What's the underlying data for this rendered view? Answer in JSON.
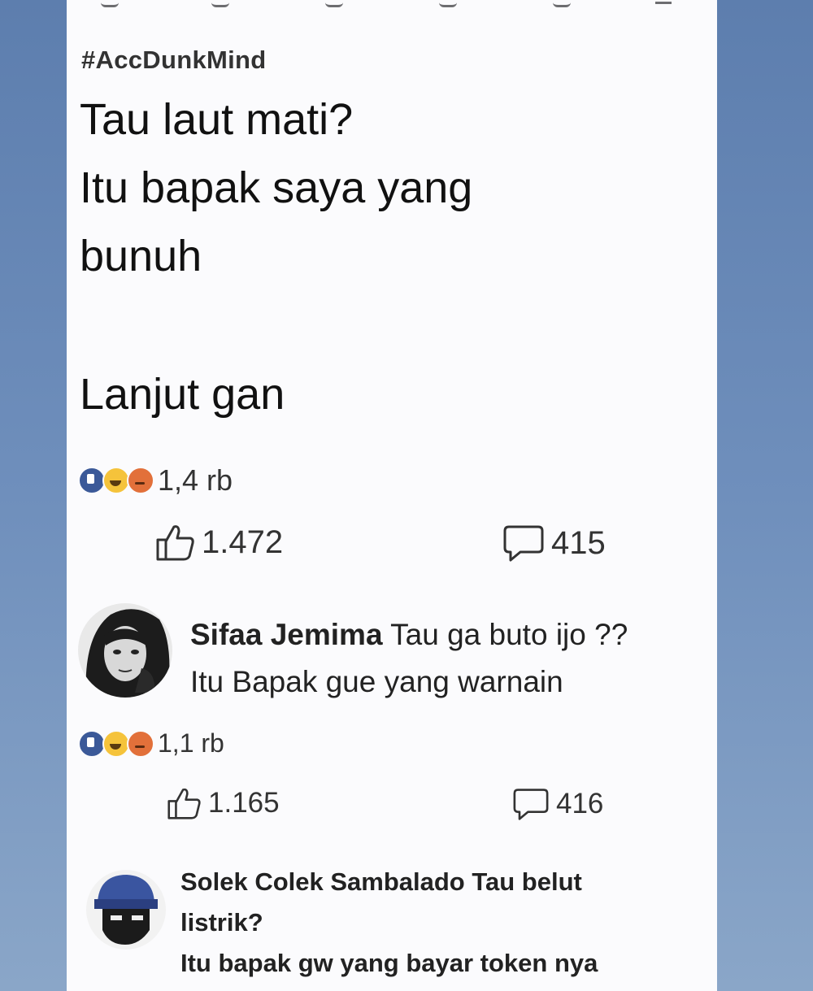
{
  "post": {
    "hashtag": "#AccDunkMind",
    "lines": [
      "Tau laut mati?",
      "Itu bapak saya yang",
      "bunuh",
      "Lanjut gan"
    ],
    "reaction_count": "1,4 rb",
    "likes": "1.472",
    "comments": "415"
  },
  "comment1": {
    "author": "Sifaa Jemima",
    "line1": "Tau ga buto ijo ??",
    "line2": "Itu Bapak gue yang warnain",
    "reaction_count": "1,1 rb",
    "likes": "1.165",
    "comments": "416"
  },
  "comment2": {
    "author": "Solek Colek Sambalado",
    "line1": "Tau belut",
    "line2": "listrik?",
    "line3": "Itu bapak gw yang bayar token nya"
  },
  "icons": {
    "reactions": [
      "like-icon",
      "haha-icon",
      "angry-icon"
    ],
    "like": "thumbs-up-icon",
    "comment": "comment-bubble-icon"
  },
  "colors": {
    "card": "#fbfbfd",
    "background": "#6f8fbc",
    "text": "#111111"
  }
}
